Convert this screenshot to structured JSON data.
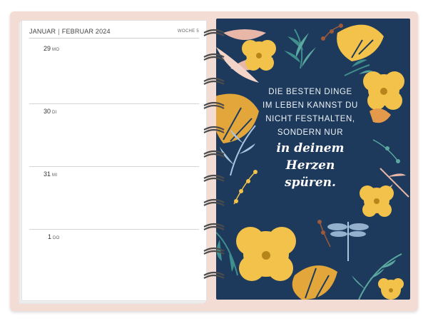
{
  "planner": {
    "month_left": "JANUAR",
    "month_right": "FEBRUAR 2024",
    "week_label": "WOCHE 5",
    "days": [
      {
        "num": "29",
        "weekday": "MO"
      },
      {
        "num": "30",
        "weekday": "DI"
      },
      {
        "num": "31",
        "weekday": "MI"
      },
      {
        "num": "1",
        "weekday": "DO"
      }
    ]
  },
  "quote": {
    "line1": "DIE BESTEN DINGE",
    "line2": "IM LEBEN KANNST DU",
    "line3": "NICHT FESTHALTEN,",
    "line4": "SONDERN NUR",
    "script1": "in deinem",
    "script2": "Herzen",
    "script3": "spüren."
  },
  "colors": {
    "cover": "#f3dcd3",
    "navy": "#1d3a5c",
    "yellow": "#f3c24a",
    "teal": "#3f8f8c",
    "rose": "#e8b7a8"
  },
  "icons": [
    "flower-icon",
    "monstera-leaf-icon",
    "fern-leaf-icon",
    "dragonfly-icon",
    "berry-branch-icon",
    "bird-icon"
  ]
}
